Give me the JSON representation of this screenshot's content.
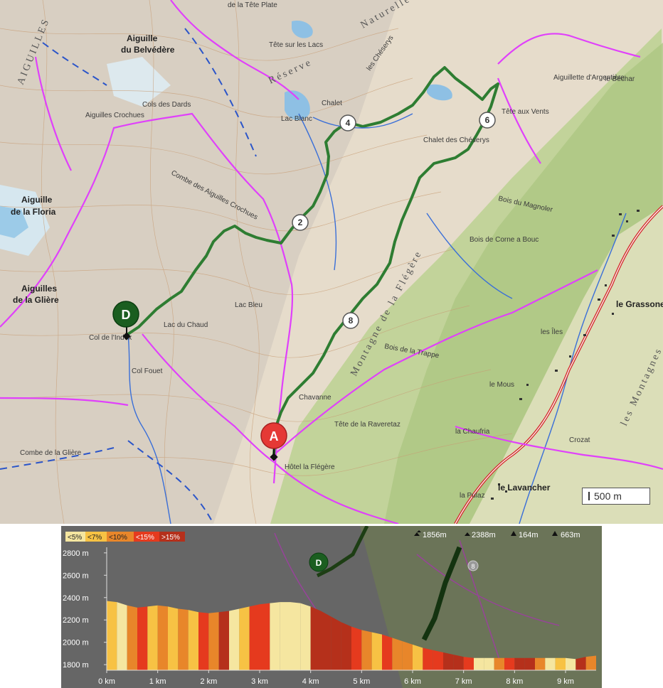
{
  "map": {
    "labels": {
      "tete_plate": "de la Tête Plate",
      "aiguilles": "AIGUILLES",
      "aiguille_belvedere": "Aiguille",
      "aiguille_belvedere_2": "du Belvédère",
      "tete_sur_lacs": "Tête sur les Lacs",
      "reserve": "Réserve",
      "les_cheserys": "les Chéserys",
      "naturelle": "Naturelle",
      "cols_dards": "Cols des Dards",
      "aiguilles_crochues": "Aiguilles Crochues",
      "lac_blanc": "Lac Blanc",
      "chalet": "Chalet",
      "aiguillette_argentiere": "Aiguillette d'Argentière",
      "le_bechar": "le Béchar",
      "tete_aux_vents": "Tête aux Vents",
      "chalet_cheserys": "Chalet des Chéserys",
      "combe_aiguilles_crochues": "Combe des Aiguilles Crochues",
      "aiguille_floria": "Aiguille",
      "aiguille_floria_2": "de la Floria",
      "bois_magnoler": "Bois du Magnoler",
      "bois_corne_bouc": "Bois de Corne a Bouc",
      "lac_bleu": "Lac Bleu",
      "aiguilles_gliere": "Aiguilles",
      "aiguilles_gliere_2": "de la Glière",
      "lac_chaud": "Lac du Chaud",
      "col_glieres": "Col de l'Index",
      "col_fouet": "Col Fouet",
      "montagne_flegere": "Montagne de la Flégère",
      "bois_trappe": "Bois de la Trappe",
      "le_grassonet": "le Grassonet",
      "les_iles": "les Îles",
      "chavanne": "Chavanne",
      "tete_raveretaz": "Tête de la Raveretaz",
      "la_chaufria": "la Chaufria",
      "crozat": "Crozat",
      "les_montagnes": "les Montagnes",
      "combe_gliere": "Combe de la Glière",
      "hotel_flegere": "Hôtel la Flégère",
      "la_pula": "la Pulaz",
      "le_lavancher": "le Lavancher",
      "le_mous": "le Mous",
      "les_tines": "Bois"
    },
    "waypoints": [
      {
        "id": "wp-2",
        "num": "2"
      },
      {
        "id": "wp-4",
        "num": "4"
      },
      {
        "id": "wp-6",
        "num": "6"
      },
      {
        "id": "wp-8",
        "num": "8"
      }
    ],
    "start_marker": "A",
    "end_marker": "D",
    "scale_label": "500 m",
    "colors": {
      "route": "#2e7d32",
      "trail": "#e040fb",
      "contour": "#c9a27e",
      "terrain": "#e8dccb",
      "forest": "#b5cc8e",
      "water": "#7aaed6",
      "road": "#d32f2f",
      "start": "#e53935",
      "end": "#1b5e20"
    }
  },
  "profile": {
    "legend": [
      "<5%",
      "<7%",
      "<10%",
      "<15%",
      ">15%"
    ],
    "legend_colors": [
      "#f5e6a0",
      "#f7c244",
      "#e8862a",
      "#e53a1e",
      "#b5301b"
    ],
    "stats": {
      "max_alt": "1856m",
      "min_alt": "2388m",
      "ascent": "164m",
      "descent": "663m"
    },
    "y_ticks": [
      "2800 m",
      "2600 m",
      "2400 m",
      "2200 m",
      "2000 m",
      "1800 m"
    ],
    "x_ticks": [
      "0 km",
      "1 km",
      "2 km",
      "3 km",
      "4 km",
      "5 km",
      "6 km",
      "7 km",
      "8 km",
      "9 km"
    ],
    "marker_d": "D",
    "marker_8": "8"
  },
  "chart_data": {
    "type": "area",
    "xlabel": "",
    "ylabel": "",
    "x_unit": "km",
    "y_unit": "m",
    "ylim": [
      1750,
      2850
    ],
    "xlim": [
      0,
      9.6
    ],
    "x": [
      0,
      0.2,
      0.4,
      0.6,
      0.8,
      1.0,
      1.2,
      1.4,
      1.6,
      1.8,
      2.0,
      2.2,
      2.4,
      2.6,
      2.8,
      3.0,
      3.2,
      3.4,
      3.6,
      3.8,
      4.0,
      4.2,
      4.4,
      4.6,
      4.8,
      5.0,
      5.2,
      5.4,
      5.6,
      5.8,
      6.0,
      6.2,
      6.4,
      6.6,
      6.8,
      7.0,
      7.2,
      7.4,
      7.6,
      7.8,
      8.0,
      8.2,
      8.4,
      8.6,
      8.8,
      9.0,
      9.2,
      9.4,
      9.6
    ],
    "y": [
      2370,
      2360,
      2330,
      2310,
      2320,
      2330,
      2320,
      2300,
      2290,
      2270,
      2260,
      2270,
      2280,
      2300,
      2320,
      2340,
      2350,
      2360,
      2360,
      2350,
      2320,
      2280,
      2230,
      2180,
      2140,
      2110,
      2090,
      2070,
      2040,
      2010,
      1980,
      1950,
      1930,
      1910,
      1890,
      1870,
      1860,
      1860,
      1860,
      1860,
      1860,
      1860,
      1860,
      1860,
      1860,
      1860,
      1850,
      1870,
      1880
    ],
    "slope_class": [
      1,
      0,
      2,
      3,
      1,
      2,
      1,
      2,
      1,
      3,
      2,
      4,
      0,
      1,
      3,
      3,
      0,
      0,
      0,
      0,
      4,
      4,
      4,
      4,
      3,
      2,
      1,
      3,
      2,
      2,
      1,
      3,
      3,
      4,
      4,
      3,
      0,
      0,
      2,
      3,
      4,
      4,
      2,
      0,
      1,
      0,
      4,
      2,
      1
    ]
  }
}
